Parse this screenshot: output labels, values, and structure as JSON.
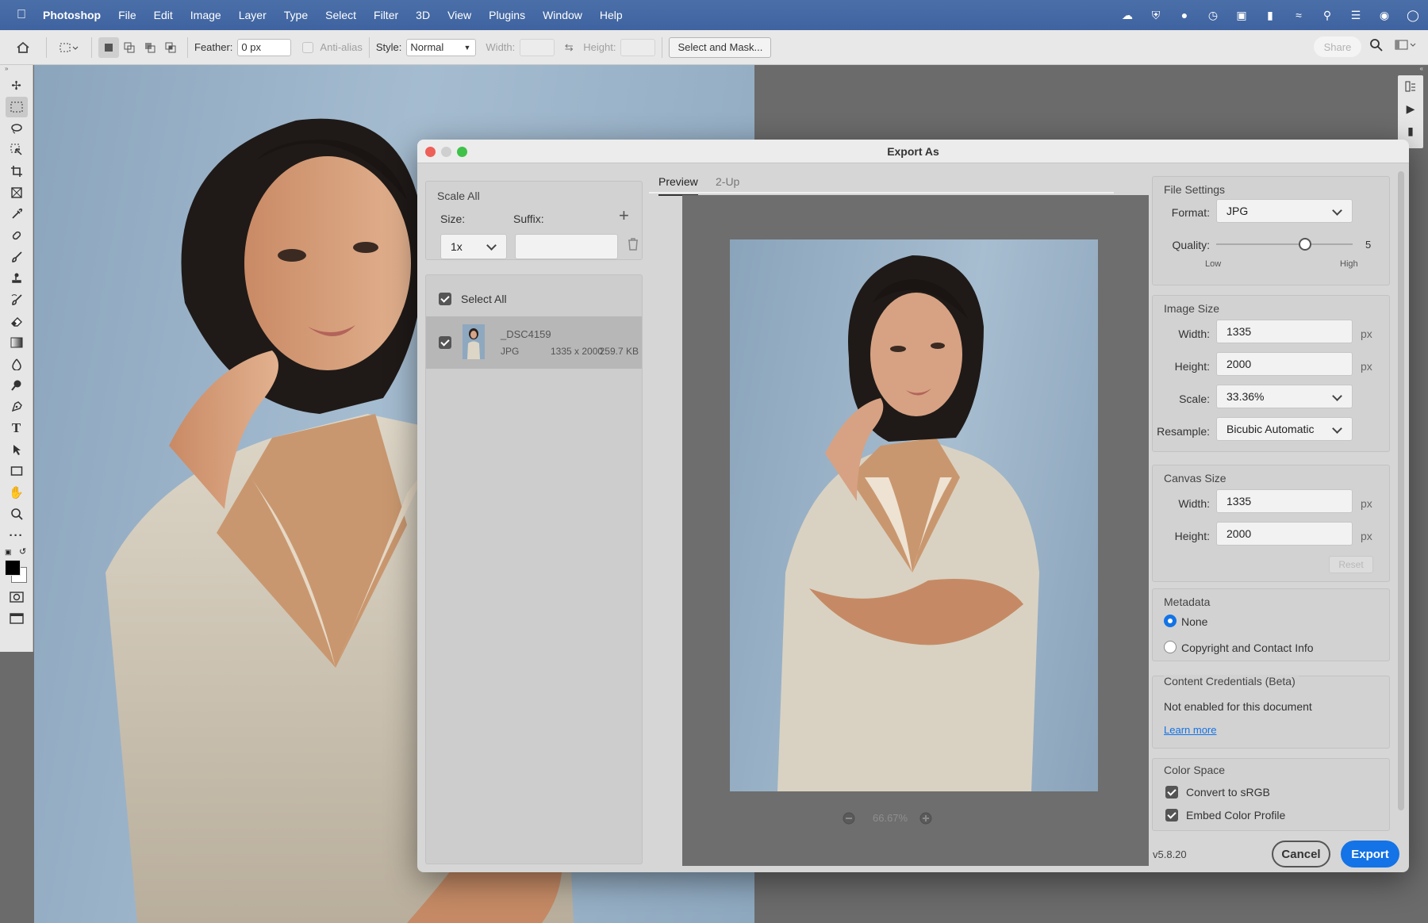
{
  "menubar": {
    "app": "Photoshop",
    "items": [
      "File",
      "Edit",
      "Image",
      "Layer",
      "Type",
      "Select",
      "Filter",
      "3D",
      "View",
      "Plugins",
      "Window",
      "Help"
    ]
  },
  "options": {
    "feather_label": "Feather:",
    "feather_value": "0 px",
    "antialias_label": "Anti-alias",
    "style_label": "Style:",
    "style_value": "Normal",
    "width_label": "Width:",
    "height_label": "Height:",
    "select_mask": "Select and Mask...",
    "share": "Share"
  },
  "dialog": {
    "title": "Export As",
    "scale": {
      "title": "Scale All",
      "size_label": "Size:",
      "suffix_label": "Suffix:",
      "size_value": "1x",
      "suffix_value": ""
    },
    "select_all": "Select All",
    "asset": {
      "name": "_DSC4159",
      "format": "JPG",
      "dimensions": "1335 x 2000",
      "filesize": "259.7 KB"
    },
    "tabs": [
      "Preview",
      "2-Up"
    ],
    "zoom": "66.67%",
    "file_settings": {
      "title": "File Settings",
      "format_label": "Format:",
      "format_value": "JPG",
      "quality_label": "Quality:",
      "quality_value": "5",
      "quality_fraction": 0.65,
      "low": "Low",
      "high": "High"
    },
    "image_size": {
      "title": "Image Size",
      "width_label": "Width:",
      "width_value": "1335",
      "height_label": "Height:",
      "height_value": "2000",
      "scale_label": "Scale:",
      "scale_value": "33.36%",
      "resample_label": "Resample:",
      "resample_value": "Bicubic Automatic",
      "unit": "px"
    },
    "canvas_size": {
      "title": "Canvas Size",
      "width_label": "Width:",
      "width_value": "1335",
      "height_label": "Height:",
      "height_value": "2000",
      "reset": "Reset",
      "unit": "px"
    },
    "metadata": {
      "title": "Metadata",
      "none": "None",
      "copyright": "Copyright and Contact Info"
    },
    "credentials": {
      "title": "Content Credentials (Beta)",
      "text": "Not enabled for this document",
      "link": "Learn more"
    },
    "color_space": {
      "title": "Color Space",
      "srgb": "Convert to sRGB",
      "embed": "Embed Color Profile"
    },
    "version": "v5.8.20",
    "cancel": "Cancel",
    "export": "Export"
  },
  "colors": {
    "menubar": "#3f63a0",
    "accent": "#1473e6",
    "backdrop": "#8ba5bd"
  }
}
